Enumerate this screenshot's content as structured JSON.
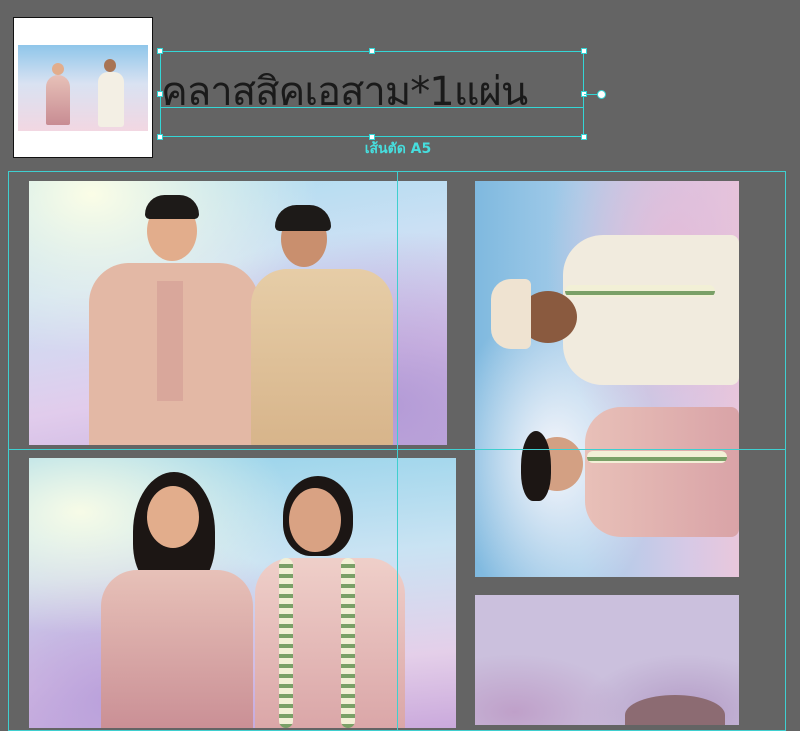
{
  "canvas": {
    "background": "#646464",
    "guide_color": "#3fcfd0",
    "selection_color": "#34d6d6"
  },
  "text_frame": {
    "content": "คลาสสิคเอสาม*1แผ่น"
  },
  "cut_label": "เส้นตัด A5",
  "thumbnail": {
    "icon": "photo-thumbnail-icon"
  },
  "photos": [
    {
      "id": "photo-1",
      "subject": "couple-in-suit-and-thai-dress"
    },
    {
      "id": "photo-2",
      "subject": "two-women-in-thai-dress"
    },
    {
      "id": "photo-3",
      "subject": "indian-wedding-couple-rotated"
    },
    {
      "id": "photo-4",
      "subject": "lavender-background-partial"
    }
  ]
}
